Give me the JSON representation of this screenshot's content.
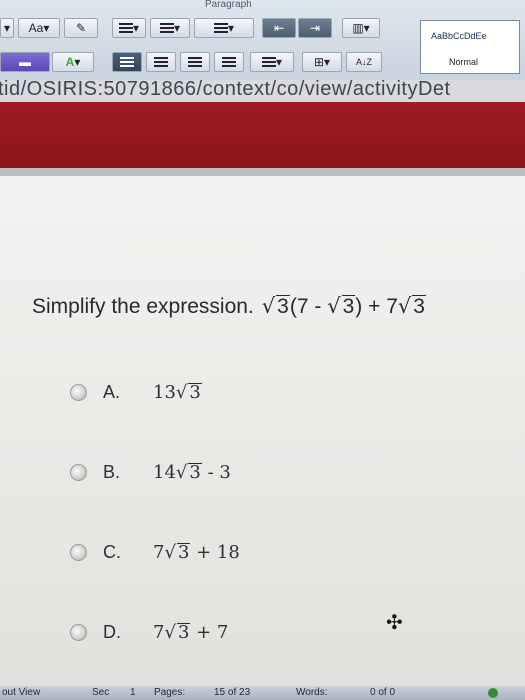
{
  "ribbon": {
    "group_label": "Paragraph",
    "font_size_button": "Aa",
    "sort_button": "A↓Z",
    "style_sample": "AaBbCcDdEe",
    "style_name": "Normal"
  },
  "url": {
    "text": "tid/OSIRIS:50791866/context/co/view/activityDet"
  },
  "question": {
    "prompt": "Simplify the expression.",
    "expr_radicand_1": "3",
    "expr_mid": "(7 - ",
    "expr_radicand_2": "3",
    "expr_close": ") + 7",
    "expr_radicand_3": "3"
  },
  "options": [
    {
      "letter": "A.",
      "coef": "13",
      "radicand": "3",
      "rest": ""
    },
    {
      "letter": "B.",
      "coef": "14",
      "radicand": "3",
      "rest": " - 3"
    },
    {
      "letter": "C.",
      "coef": "7",
      "radicand": "3",
      "rest": " + 18"
    },
    {
      "letter": "D.",
      "coef": "7",
      "radicand": "3",
      "rest": " + 7"
    }
  ],
  "status": {
    "view": "out View",
    "sec": "Sec",
    "sec_num": "1",
    "pages_label": "Pages:",
    "pages_value": "15 of 23",
    "words_label": "Words:",
    "words_value": "0 of 0"
  }
}
